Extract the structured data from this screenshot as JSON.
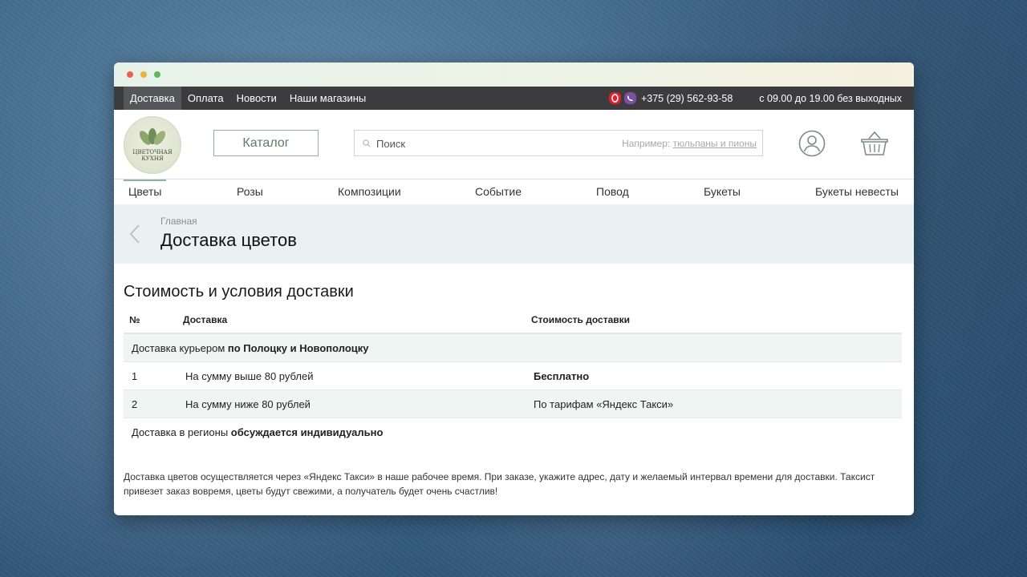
{
  "topnav": {
    "items": [
      "Доставка",
      "Оплата",
      "Новости",
      "Наши магазины"
    ],
    "active": "Доставка"
  },
  "contacts": {
    "phone": "+375 (29) 562-93-58",
    "hours": "с 09.00 до 19.00 без выходных"
  },
  "logo": {
    "line1": "ЦВЕТОЧНАЯ",
    "line2": "КУХНЯ"
  },
  "header": {
    "catalog_label": "Каталог",
    "search_placeholder": "Поиск",
    "search_example_prefix": "Например:",
    "search_example_link": "тюльпаны и пионы"
  },
  "catnav": {
    "items": [
      "Цветы",
      "Розы",
      "Композиции",
      "Событие",
      "Повод",
      "Букеты",
      "Букеты невесты"
    ]
  },
  "breadcrumb": {
    "home": "Главная"
  },
  "page": {
    "title": "Доставка цветов"
  },
  "delivery": {
    "section_title": "Стоимость и условия доставки",
    "columns": [
      "№",
      "Доставка",
      "Стоимость доставки"
    ],
    "courier_prefix": "Доставка курьером ",
    "courier_bold": "по Полоцку и Новополоцку",
    "rows": [
      {
        "num": "1",
        "condition": "На сумму выше 80 рублей",
        "cost": "Бесплатно"
      },
      {
        "num": "2",
        "condition": "На сумму ниже 80 рублей",
        "cost": "По тарифам «Яндекс Такси»"
      }
    ],
    "regions_prefix": "Доставка в регионы ",
    "regions_bold": "обсуждается индивидуально"
  },
  "note": "Доставка цветов осуществляется через «Яндекс Такси» в наше рабочее время. При заказе, укажите адрес, дату и желаемый интервал времени для доставки. Таксист привезет заказ вовремя, цветы будут свежими, а получатель будет очень счастлив!",
  "colors": {
    "topbar_bg": "#3c3c3e",
    "accent_green": "#8fb39c",
    "breadcrumb_bg": "#eaf2f1",
    "opera_red": "#e0202b",
    "viber_purple": "#7b519d"
  },
  "icons": [
    "opera-icon",
    "viber-icon",
    "search-icon",
    "user-icon",
    "cart-icon",
    "chevron-left-icon"
  ]
}
